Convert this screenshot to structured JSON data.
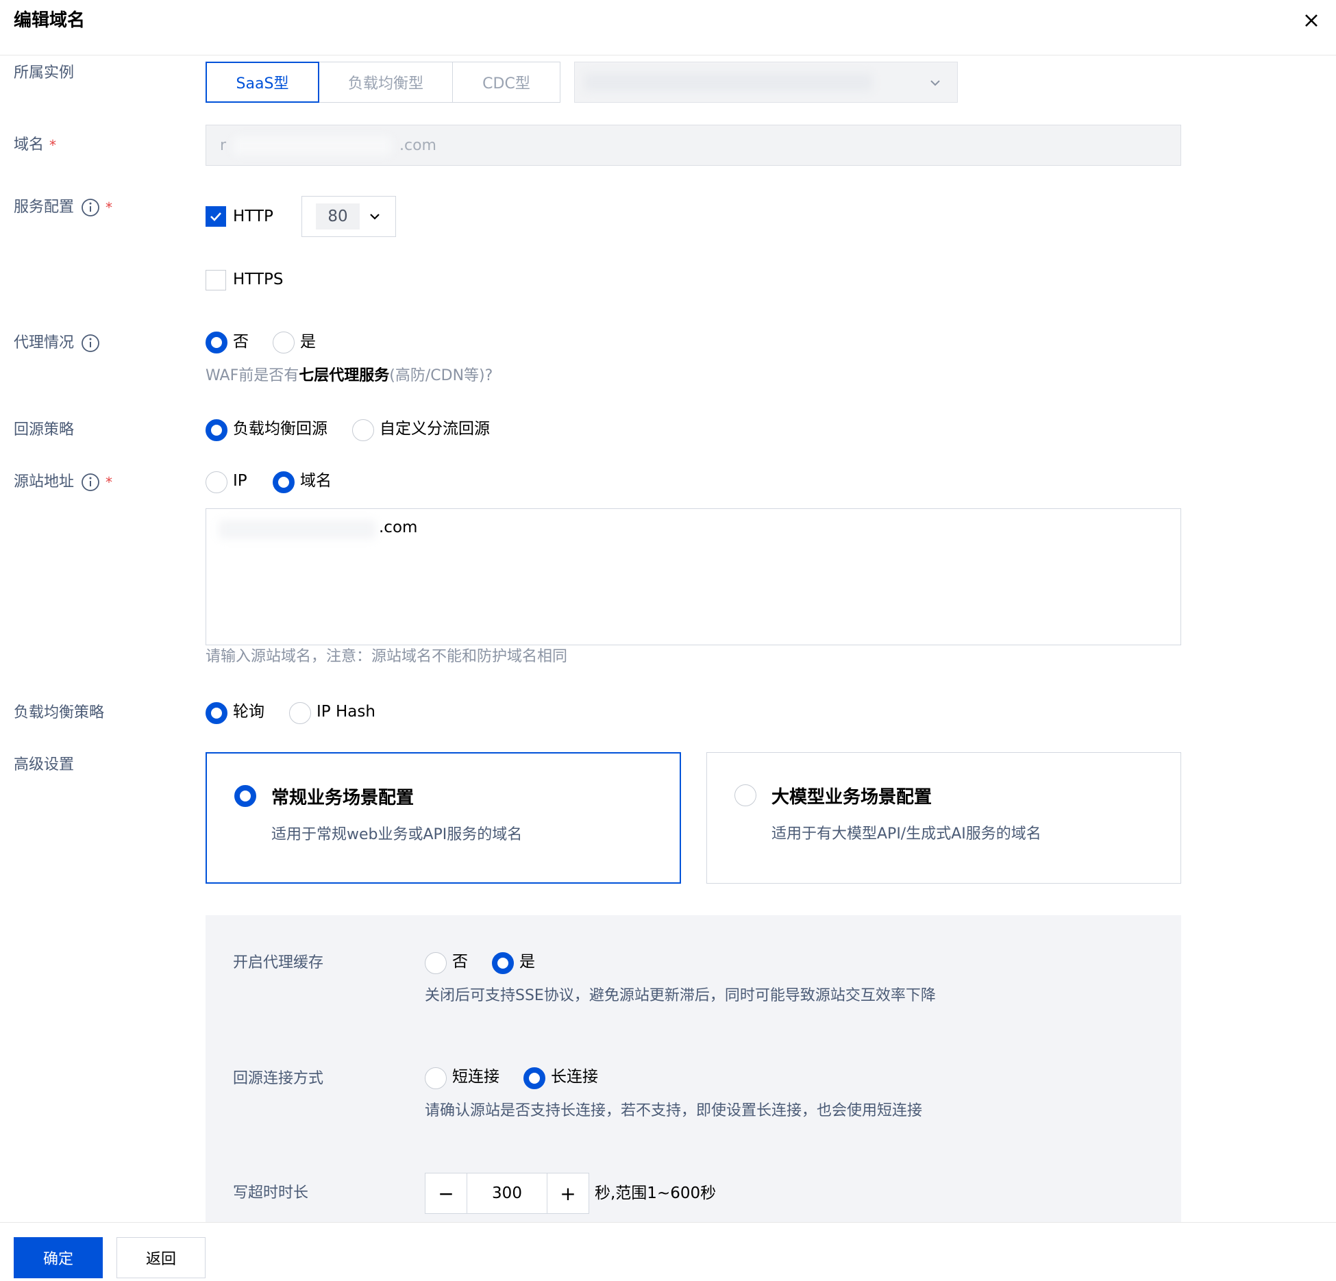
{
  "header": {
    "title": "编辑域名",
    "close_icon": "close-icon"
  },
  "instance": {
    "label": "所属实例",
    "tabs": [
      {
        "label": "SaaS型",
        "selected": true
      },
      {
        "label": "负载均衡型",
        "selected": false
      },
      {
        "label": "CDC型",
        "selected": false
      }
    ]
  },
  "domain": {
    "label": "域名",
    "value_prefix": "r",
    "value_suffix": ".com"
  },
  "service": {
    "label": "服务配置",
    "http": {
      "label": "HTTP",
      "checked": true,
      "port": "80"
    },
    "https": {
      "label": "HTTPS",
      "checked": false
    }
  },
  "proxy": {
    "label": "代理情况",
    "options": [
      {
        "label": "否",
        "selected": true
      },
      {
        "label": "是",
        "selected": false
      }
    ],
    "hint_pre": "WAF前是否有",
    "hint_bold": "七层代理服务",
    "hint_post": "(高防/CDN等)?"
  },
  "origin_strategy": {
    "label": "回源策略",
    "options": [
      {
        "label": "负载均衡回源",
        "selected": true
      },
      {
        "label": "自定义分流回源",
        "selected": false
      }
    ]
  },
  "origin_address": {
    "label": "源站地址",
    "options": [
      {
        "label": "IP",
        "selected": false
      },
      {
        "label": "域名",
        "selected": true
      }
    ],
    "value_suffix": ".com",
    "hint": "请输入源站域名，注意：源站域名不能和防护域名相同"
  },
  "lb_strategy": {
    "label": "负载均衡策略",
    "options": [
      {
        "label": "轮询",
        "selected": true
      },
      {
        "label": "IP Hash",
        "selected": false
      }
    ]
  },
  "advanced": {
    "label": "高级设置",
    "cards": [
      {
        "title": "常规业务场景配置",
        "desc": "适用于常规web业务或API服务的域名",
        "selected": true
      },
      {
        "title": "大模型业务场景配置",
        "desc": "适用于有大模型API/生成式AI服务的域名",
        "selected": false
      }
    ],
    "proxy_cache": {
      "label": "开启代理缓存",
      "options": [
        {
          "label": "否",
          "selected": false
        },
        {
          "label": "是",
          "selected": true
        }
      ],
      "hint": "关闭后可支持SSE协议，避免源站更新滞后，同时可能导致源站交互效率下降"
    },
    "connection": {
      "label": "回源连接方式",
      "options": [
        {
          "label": "短连接",
          "selected": false
        },
        {
          "label": "长连接",
          "selected": true
        }
      ],
      "hint": "请确认源站是否支持长连接，若不支持，即使设置长连接，也会使用短连接"
    },
    "write_timeout": {
      "label": "写超时时长",
      "value": "300",
      "minus": "−",
      "plus": "+",
      "unit": "秒,范围1~600秒"
    }
  },
  "footer": {
    "confirm": "确定",
    "back": "返回"
  },
  "colors": {
    "primary": "#0052d9",
    "required": "#e54545"
  }
}
